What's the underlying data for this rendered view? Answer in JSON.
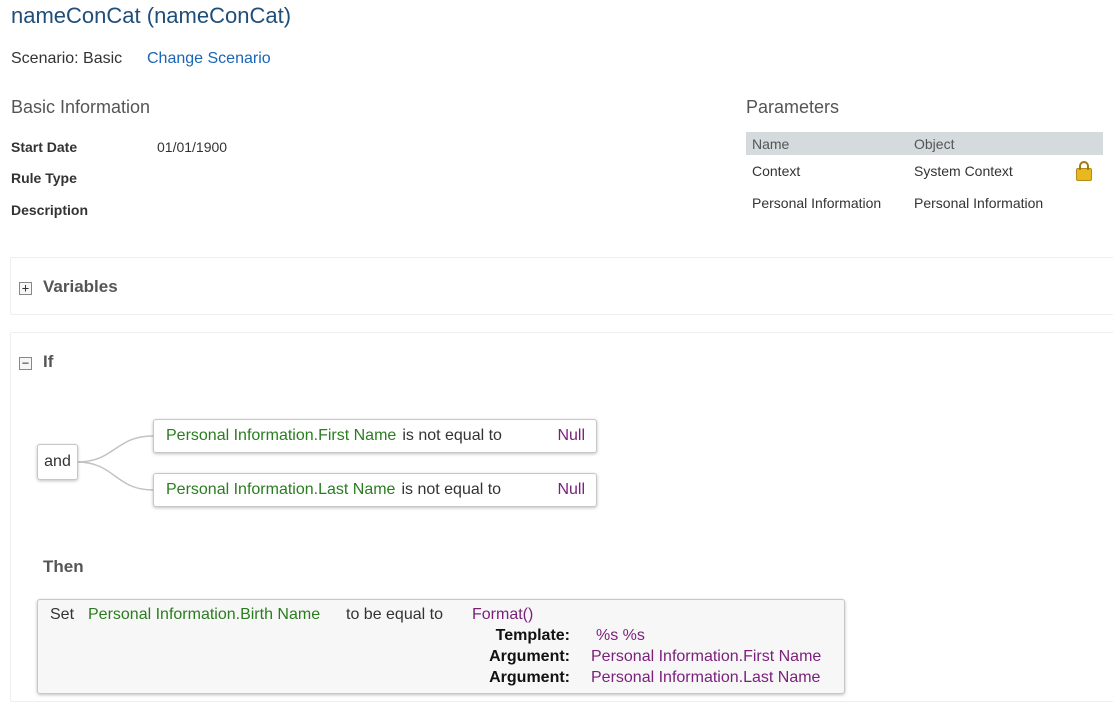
{
  "header": {
    "title": "nameConCat (nameConCat)",
    "scenario_label": "Scenario: Basic",
    "change_scenario": "Change Scenario"
  },
  "basic_info": {
    "title": "Basic Information",
    "fields": [
      {
        "label": "Start Date",
        "value": "01/01/1900"
      },
      {
        "label": "Rule Type",
        "value": ""
      },
      {
        "label": "Description",
        "value": ""
      }
    ]
  },
  "parameters": {
    "title": "Parameters",
    "columns": [
      "Name",
      "Object"
    ],
    "rows": [
      {
        "name": "Context",
        "object": "System Context",
        "icon": "lock-icon"
      },
      {
        "name": "Personal Information",
        "object": "Personal Information"
      }
    ]
  },
  "variables": {
    "title": "Variables",
    "toggle": "+"
  },
  "if_section": {
    "title": "If",
    "toggle": "−",
    "operator": "and",
    "conditions": [
      {
        "field": "Personal Information.First Name",
        "op": "is not equal to",
        "value": "Null"
      },
      {
        "field": "Personal Information.Last Name",
        "op": "is not equal to",
        "value": "Null"
      }
    ]
  },
  "then_section": {
    "title": "Then",
    "action": {
      "verb": "Set",
      "target": "Personal Information.Birth Name",
      "op": "to be equal to",
      "func": "Format()",
      "args": [
        {
          "label": "Template:",
          "value": "%s %s"
        },
        {
          "label": "Argument:",
          "value": "Personal Information.First Name"
        },
        {
          "label": "Argument:",
          "value": "Personal Information.Last Name"
        }
      ]
    }
  },
  "colors": {
    "title": "#1f4e79",
    "link": "#1b65b6",
    "field": "#2a7d1f",
    "value": "#7a1f7a"
  }
}
